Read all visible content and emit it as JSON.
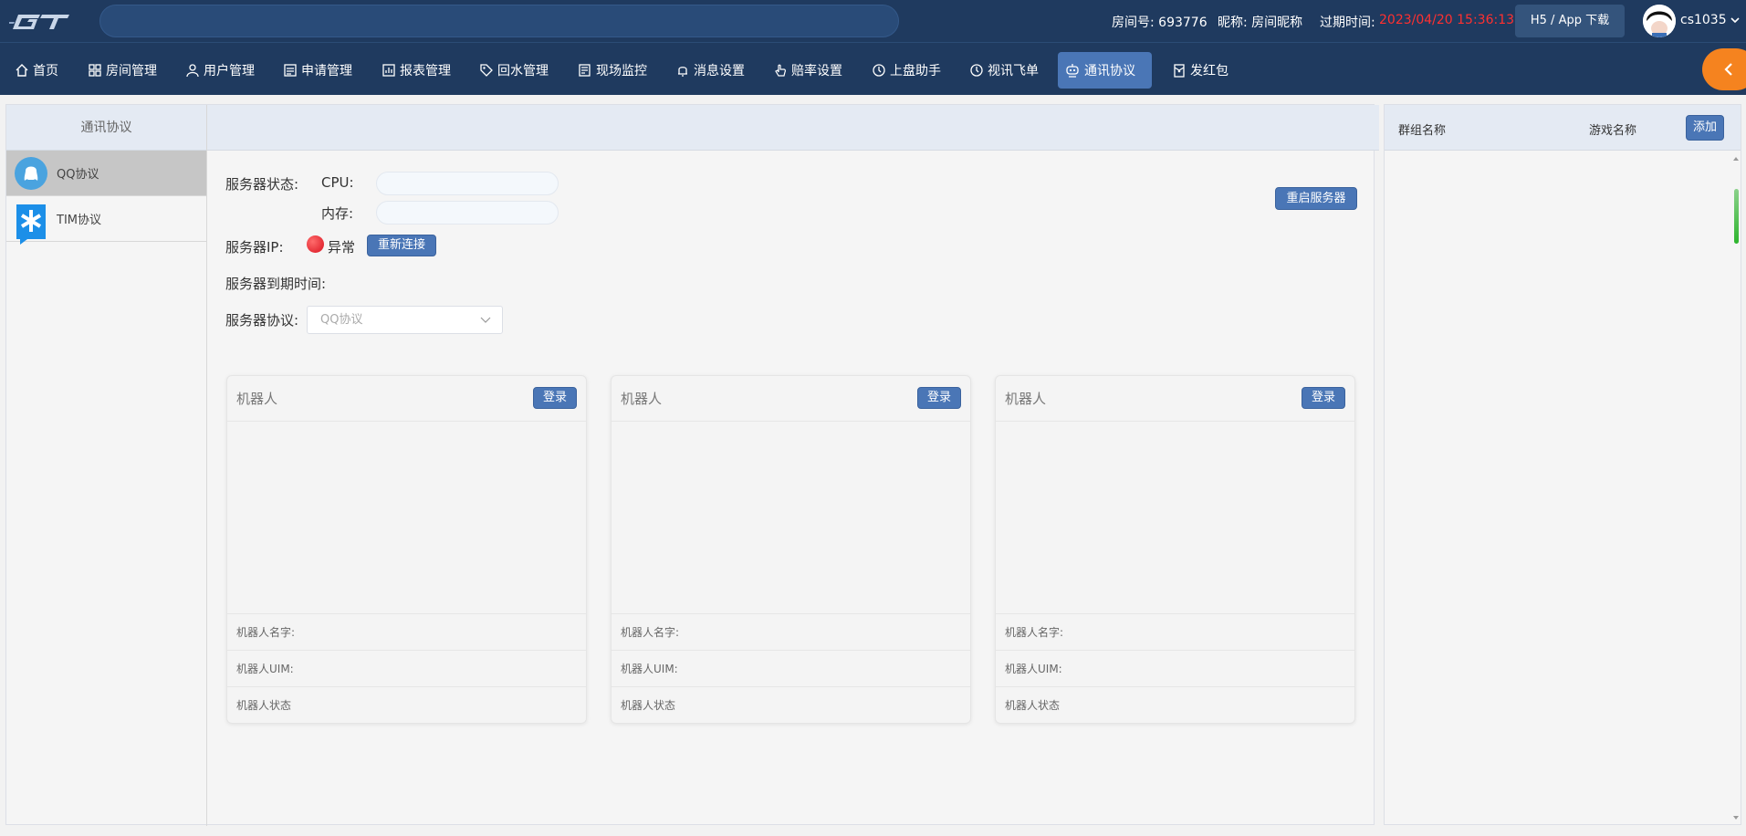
{
  "header": {
    "logo_text": "GT",
    "room_label": "房间号: 693776",
    "nickname_label": "昵称: 房间昵称",
    "expire_label": "过期时间:",
    "expire_value": "2023/04/20 15:36:13",
    "h5_button": "H5 / App 下载",
    "username": "cs1035"
  },
  "nav": {
    "items": [
      {
        "label": "首页",
        "icon": "home-icon"
      },
      {
        "label": "房间管理",
        "icon": "grid-icon"
      },
      {
        "label": "用户管理",
        "icon": "user-icon"
      },
      {
        "label": "申请管理",
        "icon": "form-icon"
      },
      {
        "label": "报表管理",
        "icon": "report-icon"
      },
      {
        "label": "回水管理",
        "icon": "tag-icon"
      },
      {
        "label": "现场监控",
        "icon": "monitor-icon"
      },
      {
        "label": "消息设置",
        "icon": "bell-icon"
      },
      {
        "label": "赔率设置",
        "icon": "hand-icon"
      },
      {
        "label": "上盘助手",
        "icon": "clock-icon"
      },
      {
        "label": "视讯飞单",
        "icon": "clock-icon"
      },
      {
        "label": "通讯协议",
        "icon": "robot-icon"
      },
      {
        "label": "发红包",
        "icon": "redpacket-icon"
      }
    ],
    "active_index": 11,
    "active_color": "#4a76b6",
    "bar_color": "#1f3a5f",
    "collapse_color": "#f5831f"
  },
  "left": {
    "title": "通讯协议",
    "protocols": [
      {
        "label": "QQ协议",
        "icon": "qq-icon",
        "selected": true
      },
      {
        "label": "TIM协议",
        "icon": "tim-icon",
        "selected": false
      }
    ]
  },
  "server": {
    "status_label": "服务器状态:",
    "cpu_label": "CPU:",
    "mem_label": "内存:",
    "ip_label": "服务器IP:",
    "status_text": "异常",
    "reconnect_button": "重新连接",
    "expire_label": "服务器到期时间:",
    "protocol_label": "服务器协议:",
    "protocol_placeholder": "QQ协议",
    "restart_button": "重启服务器"
  },
  "robots": [
    {
      "title": "机器人",
      "login": "登录",
      "name_label": "机器人名字:",
      "uim_label": "机器人UIM:",
      "status_label": "机器人状态"
    },
    {
      "title": "机器人",
      "login": "登录",
      "name_label": "机器人名字:",
      "uim_label": "机器人UIM:",
      "status_label": "机器人状态"
    },
    {
      "title": "机器人",
      "login": "登录",
      "name_label": "机器人名字:",
      "uim_label": "机器人UIM:",
      "status_label": "机器人状态"
    }
  ],
  "right": {
    "group_col": "群组名称",
    "game_col": "游戏名称",
    "add_button": "添加"
  }
}
